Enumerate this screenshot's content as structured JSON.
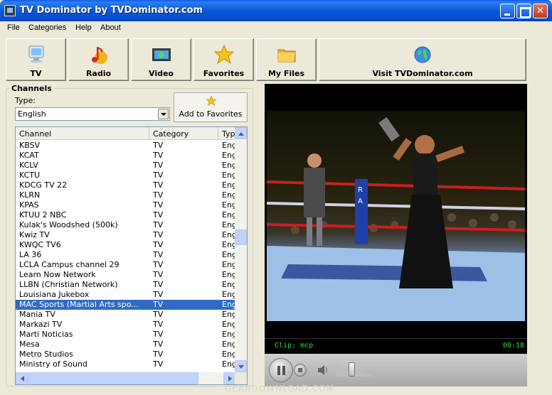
{
  "window": {
    "title": "TV Dominator by TVDominator.com"
  },
  "menu": [
    "File",
    "Categories",
    "Help",
    "About"
  ],
  "toolbar": [
    {
      "label": "TV",
      "icon": "monitor-icon"
    },
    {
      "label": "Radio",
      "icon": "music-notes-icon"
    },
    {
      "label": "Video",
      "icon": "video-icon"
    },
    {
      "label": "Favorites",
      "icon": "star-icon"
    },
    {
      "label": "My Files",
      "icon": "folder-icon"
    },
    {
      "label": "Visit TVDominator.com",
      "icon": "globe-icon"
    }
  ],
  "channels_panel": {
    "legend": "Channels",
    "type_label": "Type:",
    "type_value": "English",
    "add_favorites_label": "Add to Favorites",
    "columns": [
      "Channel",
      "Category",
      "Type"
    ],
    "rows": [
      [
        "KBSV",
        "TV",
        "Eng"
      ],
      [
        "KCAT",
        "TV",
        "Eng"
      ],
      [
        "KCLV",
        "TV",
        "Eng"
      ],
      [
        "KCTU",
        "TV",
        "Eng"
      ],
      [
        "KDCG TV 22",
        "TV",
        "Eng"
      ],
      [
        "KLRN",
        "TV",
        "Eng"
      ],
      [
        "KPAS",
        "TV",
        "Eng"
      ],
      [
        "KTUU 2 NBC",
        "TV",
        "Eng"
      ],
      [
        "Kulak's Woodshed (500k)",
        "TV",
        "Eng"
      ],
      [
        "Kwiz TV",
        "TV",
        "Eng"
      ],
      [
        "KWQC TV6",
        "TV",
        "Eng"
      ],
      [
        "LA 36",
        "TV",
        "Eng"
      ],
      [
        "LCLA Campus channel 29",
        "TV",
        "Eng"
      ],
      [
        "Learn Now Network",
        "TV",
        "Eng"
      ],
      [
        "LLBN (Christian Network)",
        "TV",
        "Eng"
      ],
      [
        "Louisiana Jukebox",
        "TV",
        "Eng"
      ],
      [
        "MAC Sports (Martial Arts spo...",
        "TV",
        "Eng"
      ],
      [
        "Mania TV",
        "TV",
        "Eng"
      ],
      [
        "Markazi TV",
        "TV",
        "Eng"
      ],
      [
        "Marti Noticias",
        "TV",
        "Eng"
      ],
      [
        "Mesa",
        "TV",
        "Eng"
      ],
      [
        "Metro Studios",
        "TV",
        "Eng"
      ],
      [
        "Ministry of Sound",
        "TV",
        "Eng"
      ]
    ],
    "selected_row": 16
  },
  "player": {
    "clip_text": "Clip: mcp",
    "time_text": "00:18",
    "volume_percent": 40
  },
  "watermark": "GEARDOWNLOAD.COM",
  "colors": {
    "title_bar": "#0A58D8",
    "selection": "#316AC5",
    "status_text": "#3ED83E"
  }
}
